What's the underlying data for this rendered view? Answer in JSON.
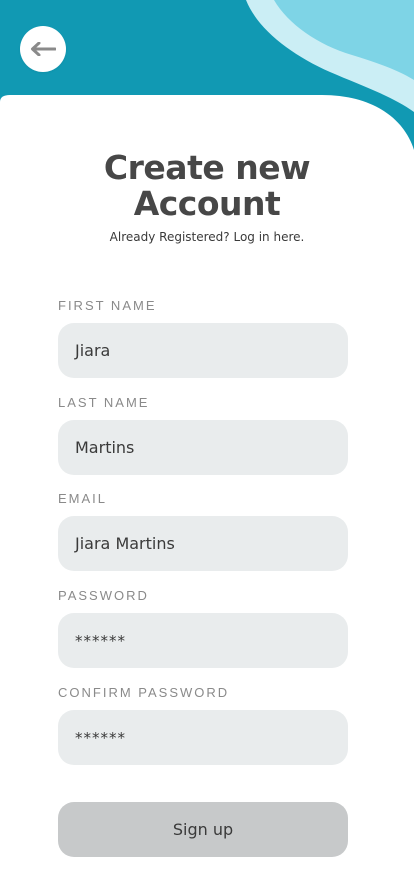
{
  "header": {
    "back_icon": "arrow-left-icon",
    "colors": {
      "teal": "#1199b3",
      "light_blue": "#7ed4e6",
      "pale_blue": "#cbeef5"
    }
  },
  "title_line1": "Create new",
  "title_line2": "Account",
  "subtitle": "Already Registered? Log in here.",
  "form": {
    "first_name": {
      "label": "FIRST NAME",
      "value": "Jiara"
    },
    "last_name": {
      "label": "LAST NAME",
      "value": "Martins"
    },
    "email": {
      "label": "EMAIL",
      "value": "Jiara Martins"
    },
    "password": {
      "label": "PASSWORD",
      "value": "******"
    },
    "confirm_password": {
      "label": "CONFIRM PASSWORD",
      "value": "******"
    }
  },
  "signup_label": "Sign up"
}
